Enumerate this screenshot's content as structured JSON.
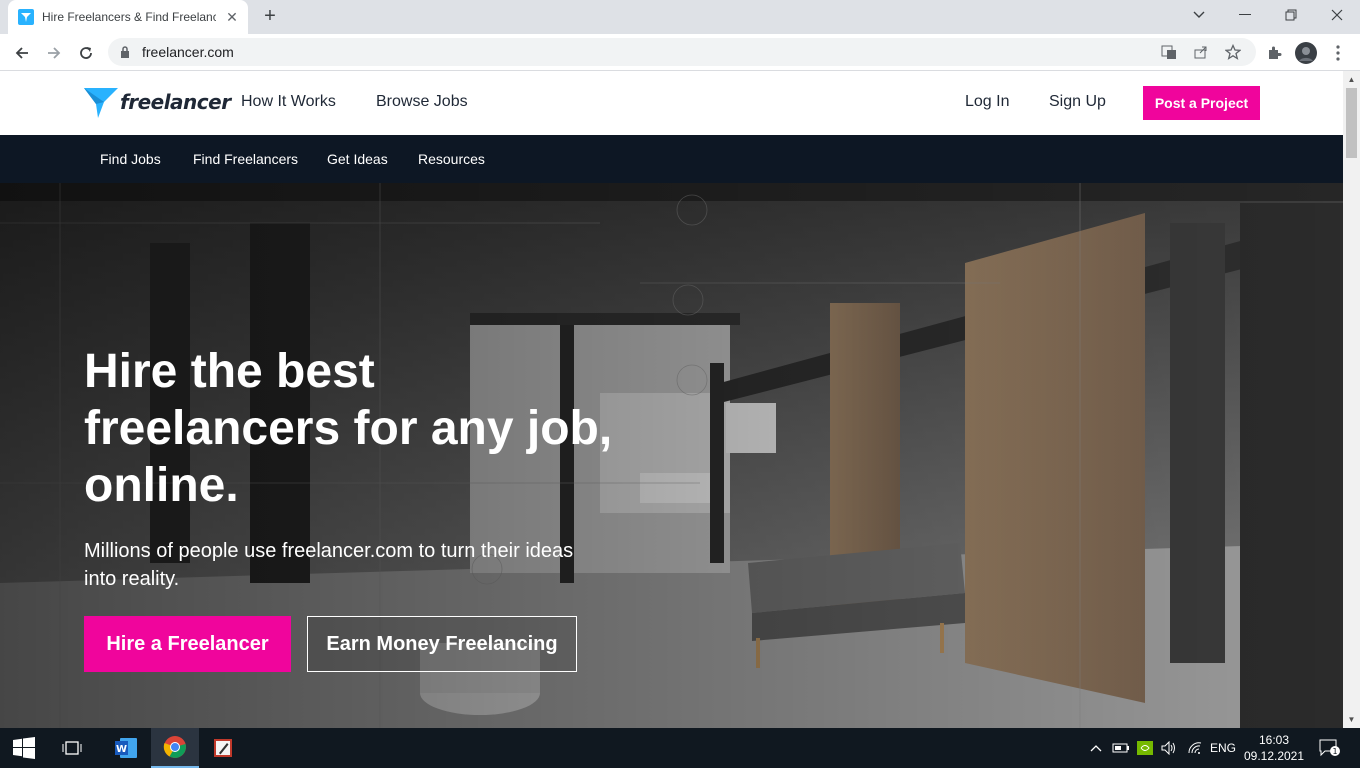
{
  "browser": {
    "tab_title": "Hire Freelancers & Find Freelance Jobs Online",
    "tab_close": "✕",
    "new_tab": "+",
    "url": "freelancer.com"
  },
  "site": {
    "logo_text": "freelancer",
    "header": {
      "how_it_works": "How It Works",
      "browse_jobs": "Browse Jobs",
      "log_in": "Log In",
      "sign_up": "Sign Up",
      "post_project": "Post a Project"
    },
    "subnav": [
      "Find Jobs",
      "Find Freelancers",
      "Get Ideas",
      "Resources"
    ],
    "hero": {
      "title_lines": [
        "Hire the best",
        "freelancers for any job,",
        "online."
      ],
      "subtitle_lines": [
        "Millions of people use freelancer.com to turn their ideas",
        "into reality."
      ],
      "hire_button": "Hire a Freelancer",
      "earn_button": "Earn Money Freelancing"
    }
  },
  "taskbar": {
    "language": "ENG",
    "time": "16:03",
    "date": "09.12.2021",
    "notification_count": "1"
  },
  "colors": {
    "brand_pink": "#f0059c",
    "brand_blue": "#29b2fe",
    "navy": "#0d1724"
  }
}
